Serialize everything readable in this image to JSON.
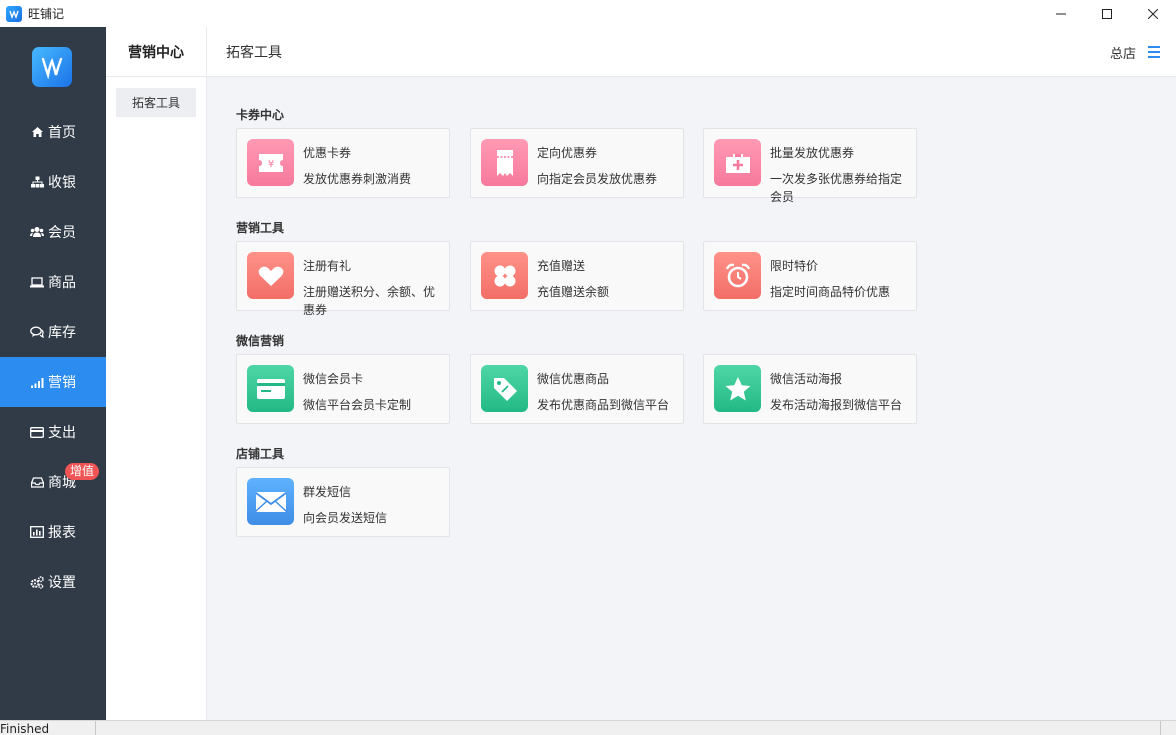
{
  "app": {
    "title": "旺铺记"
  },
  "nav": {
    "items": [
      {
        "label": "首页",
        "icon": "home-icon"
      },
      {
        "label": "收银",
        "icon": "sitemap-icon"
      },
      {
        "label": "会员",
        "icon": "users-icon"
      },
      {
        "label": "商品",
        "icon": "laptop-icon"
      },
      {
        "label": "库存",
        "icon": "comments-icon"
      },
      {
        "label": "营销",
        "icon": "signal-icon",
        "active": true
      },
      {
        "label": "支出",
        "icon": "credit-card-icon"
      },
      {
        "label": "商城",
        "icon": "inbox-icon",
        "badge": "增值"
      },
      {
        "label": "报表",
        "icon": "chart-icon"
      },
      {
        "label": "设置",
        "icon": "gears-icon"
      }
    ]
  },
  "subnav": {
    "title": "营销中心",
    "items": [
      {
        "label": "拓客工具",
        "active": true
      }
    ]
  },
  "header": {
    "title": "拓客工具",
    "store": "总店"
  },
  "sections": [
    {
      "title": "卡券中心",
      "cards": [
        {
          "name": "优惠卡券",
          "desc": "发放优惠券刺激消费",
          "icon": "ticket-icon",
          "color": "#f7799b"
        },
        {
          "name": "定向优惠券",
          "desc": "向指定会员发放优惠券",
          "icon": "coupon-icon",
          "color": "#f7799b"
        },
        {
          "name": "批量发放优惠券",
          "desc": "一次发多张优惠券给指定会员",
          "icon": "first-aid-icon",
          "color": "#f7799b"
        }
      ]
    },
    {
      "title": "营销工具",
      "cards": [
        {
          "name": "注册有礼",
          "desc": "注册赠送积分、余额、优惠券",
          "icon": "heart-icon",
          "color": "#f26e67"
        },
        {
          "name": "充值赠送",
          "desc": "充值赠送余额",
          "icon": "clover-icon",
          "color": "#f26e67"
        },
        {
          "name": "限时特价",
          "desc": "指定时间商品特价优惠",
          "icon": "alarm-clock-icon",
          "color": "#f26e67"
        }
      ]
    },
    {
      "title": "微信营销",
      "cards": [
        {
          "name": "微信会员卡",
          "desc": "微信平台会员卡定制",
          "icon": "member-card-icon",
          "color": "#22b985"
        },
        {
          "name": "微信优惠商品",
          "desc": "发布优惠商品到微信平台",
          "icon": "tag-icon",
          "color": "#22b985"
        },
        {
          "name": "微信活动海报",
          "desc": "发布活动海报到微信平台",
          "icon": "star-icon",
          "color": "#22b985"
        }
      ]
    },
    {
      "title": "店铺工具",
      "cards": [
        {
          "name": "群发短信",
          "desc": "向会员发送短信",
          "icon": "envelope-icon",
          "color": "#3f8de6"
        }
      ]
    }
  ],
  "statusbar": {
    "text": "Finished"
  }
}
